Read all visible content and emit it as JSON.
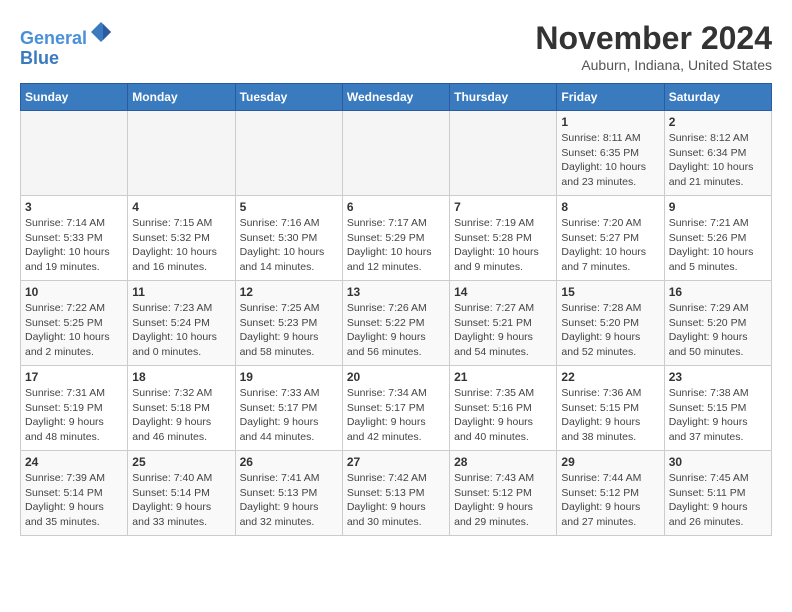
{
  "header": {
    "logo_line1": "General",
    "logo_line2": "Blue",
    "month_title": "November 2024",
    "location": "Auburn, Indiana, United States"
  },
  "weekdays": [
    "Sunday",
    "Monday",
    "Tuesday",
    "Wednesday",
    "Thursday",
    "Friday",
    "Saturday"
  ],
  "weeks": [
    [
      {
        "day": "",
        "info": ""
      },
      {
        "day": "",
        "info": ""
      },
      {
        "day": "",
        "info": ""
      },
      {
        "day": "",
        "info": ""
      },
      {
        "day": "",
        "info": ""
      },
      {
        "day": "1",
        "info": "Sunrise: 8:11 AM\nSunset: 6:35 PM\nDaylight: 10 hours and 23 minutes."
      },
      {
        "day": "2",
        "info": "Sunrise: 8:12 AM\nSunset: 6:34 PM\nDaylight: 10 hours and 21 minutes."
      }
    ],
    [
      {
        "day": "3",
        "info": "Sunrise: 7:14 AM\nSunset: 5:33 PM\nDaylight: 10 hours and 19 minutes."
      },
      {
        "day": "4",
        "info": "Sunrise: 7:15 AM\nSunset: 5:32 PM\nDaylight: 10 hours and 16 minutes."
      },
      {
        "day": "5",
        "info": "Sunrise: 7:16 AM\nSunset: 5:30 PM\nDaylight: 10 hours and 14 minutes."
      },
      {
        "day": "6",
        "info": "Sunrise: 7:17 AM\nSunset: 5:29 PM\nDaylight: 10 hours and 12 minutes."
      },
      {
        "day": "7",
        "info": "Sunrise: 7:19 AM\nSunset: 5:28 PM\nDaylight: 10 hours and 9 minutes."
      },
      {
        "day": "8",
        "info": "Sunrise: 7:20 AM\nSunset: 5:27 PM\nDaylight: 10 hours and 7 minutes."
      },
      {
        "day": "9",
        "info": "Sunrise: 7:21 AM\nSunset: 5:26 PM\nDaylight: 10 hours and 5 minutes."
      }
    ],
    [
      {
        "day": "10",
        "info": "Sunrise: 7:22 AM\nSunset: 5:25 PM\nDaylight: 10 hours and 2 minutes."
      },
      {
        "day": "11",
        "info": "Sunrise: 7:23 AM\nSunset: 5:24 PM\nDaylight: 10 hours and 0 minutes."
      },
      {
        "day": "12",
        "info": "Sunrise: 7:25 AM\nSunset: 5:23 PM\nDaylight: 9 hours and 58 minutes."
      },
      {
        "day": "13",
        "info": "Sunrise: 7:26 AM\nSunset: 5:22 PM\nDaylight: 9 hours and 56 minutes."
      },
      {
        "day": "14",
        "info": "Sunrise: 7:27 AM\nSunset: 5:21 PM\nDaylight: 9 hours and 54 minutes."
      },
      {
        "day": "15",
        "info": "Sunrise: 7:28 AM\nSunset: 5:20 PM\nDaylight: 9 hours and 52 minutes."
      },
      {
        "day": "16",
        "info": "Sunrise: 7:29 AM\nSunset: 5:20 PM\nDaylight: 9 hours and 50 minutes."
      }
    ],
    [
      {
        "day": "17",
        "info": "Sunrise: 7:31 AM\nSunset: 5:19 PM\nDaylight: 9 hours and 48 minutes."
      },
      {
        "day": "18",
        "info": "Sunrise: 7:32 AM\nSunset: 5:18 PM\nDaylight: 9 hours and 46 minutes."
      },
      {
        "day": "19",
        "info": "Sunrise: 7:33 AM\nSunset: 5:17 PM\nDaylight: 9 hours and 44 minutes."
      },
      {
        "day": "20",
        "info": "Sunrise: 7:34 AM\nSunset: 5:17 PM\nDaylight: 9 hours and 42 minutes."
      },
      {
        "day": "21",
        "info": "Sunrise: 7:35 AM\nSunset: 5:16 PM\nDaylight: 9 hours and 40 minutes."
      },
      {
        "day": "22",
        "info": "Sunrise: 7:36 AM\nSunset: 5:15 PM\nDaylight: 9 hours and 38 minutes."
      },
      {
        "day": "23",
        "info": "Sunrise: 7:38 AM\nSunset: 5:15 PM\nDaylight: 9 hours and 37 minutes."
      }
    ],
    [
      {
        "day": "24",
        "info": "Sunrise: 7:39 AM\nSunset: 5:14 PM\nDaylight: 9 hours and 35 minutes."
      },
      {
        "day": "25",
        "info": "Sunrise: 7:40 AM\nSunset: 5:14 PM\nDaylight: 9 hours and 33 minutes."
      },
      {
        "day": "26",
        "info": "Sunrise: 7:41 AM\nSunset: 5:13 PM\nDaylight: 9 hours and 32 minutes."
      },
      {
        "day": "27",
        "info": "Sunrise: 7:42 AM\nSunset: 5:13 PM\nDaylight: 9 hours and 30 minutes."
      },
      {
        "day": "28",
        "info": "Sunrise: 7:43 AM\nSunset: 5:12 PM\nDaylight: 9 hours and 29 minutes."
      },
      {
        "day": "29",
        "info": "Sunrise: 7:44 AM\nSunset: 5:12 PM\nDaylight: 9 hours and 27 minutes."
      },
      {
        "day": "30",
        "info": "Sunrise: 7:45 AM\nSunset: 5:11 PM\nDaylight: 9 hours and 26 minutes."
      }
    ]
  ]
}
